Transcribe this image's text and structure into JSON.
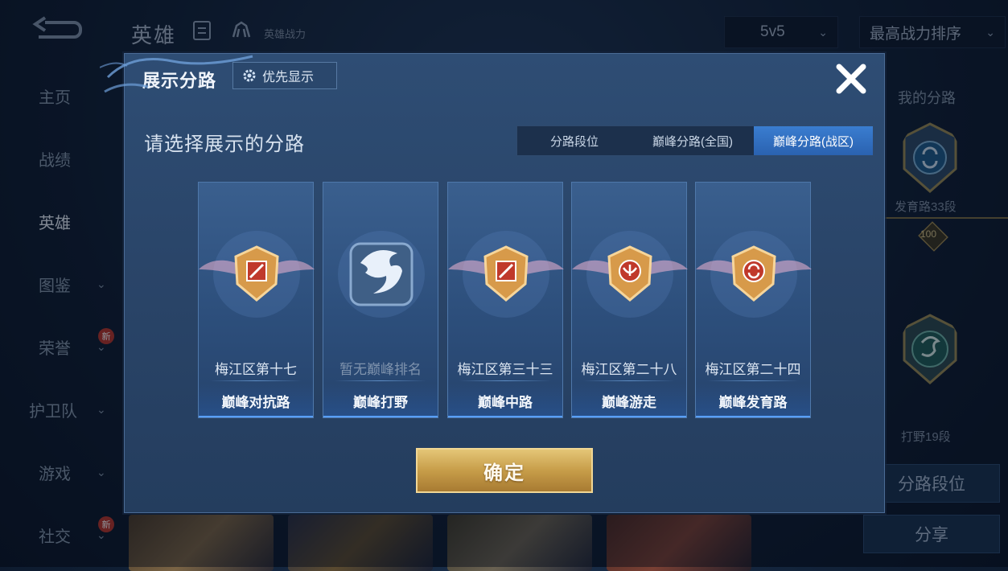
{
  "header": {
    "title": "英雄",
    "power_label": "英雄战力",
    "mode_select": "5v5",
    "sort_select": "最高战力排序"
  },
  "sidebar": {
    "items": [
      {
        "label": "主页"
      },
      {
        "label": "战绩"
      },
      {
        "label": "英雄"
      },
      {
        "label": "图鉴"
      },
      {
        "label": "荣誉",
        "badge": "新"
      },
      {
        "label": "护卫队"
      },
      {
        "label": "游戏"
      },
      {
        "label": "社交",
        "badge": "新"
      }
    ]
  },
  "right_panel": {
    "title": "我的分路",
    "badge1_label": "发育路33段",
    "badge1_number": "100",
    "badge2_label": "打野19段",
    "lane_rank_button": "分路段位",
    "share_button": "分享"
  },
  "modal": {
    "title": "展示分路",
    "priority_button": "优先显示",
    "subtitle": "请选择展示的分路",
    "tabs": [
      {
        "label": "分路段位"
      },
      {
        "label": "巅峰分路(全国)"
      },
      {
        "label": "巅峰分路(战区)"
      }
    ],
    "active_tab": 2,
    "cards": [
      {
        "rank": "梅江区第十七",
        "lane": "巅峰对抗路",
        "icon": "top-lane-icon"
      },
      {
        "rank": "暂无巅峰排名",
        "lane": "巅峰打野",
        "icon": "jungle-dragon-icon"
      },
      {
        "rank": "梅江区第三十三",
        "lane": "巅峰中路",
        "icon": "mid-lane-icon"
      },
      {
        "rank": "梅江区第二十八",
        "lane": "巅峰游走",
        "icon": "support-lane-icon"
      },
      {
        "rank": "梅江区第二十四",
        "lane": "巅峰发育路",
        "icon": "carry-lane-icon"
      }
    ],
    "confirm_button": "确定"
  },
  "colors": {
    "accent_blue": "#2a62b0",
    "confirm_gold": "#c79d49",
    "modal_bg": "#2a4569"
  }
}
